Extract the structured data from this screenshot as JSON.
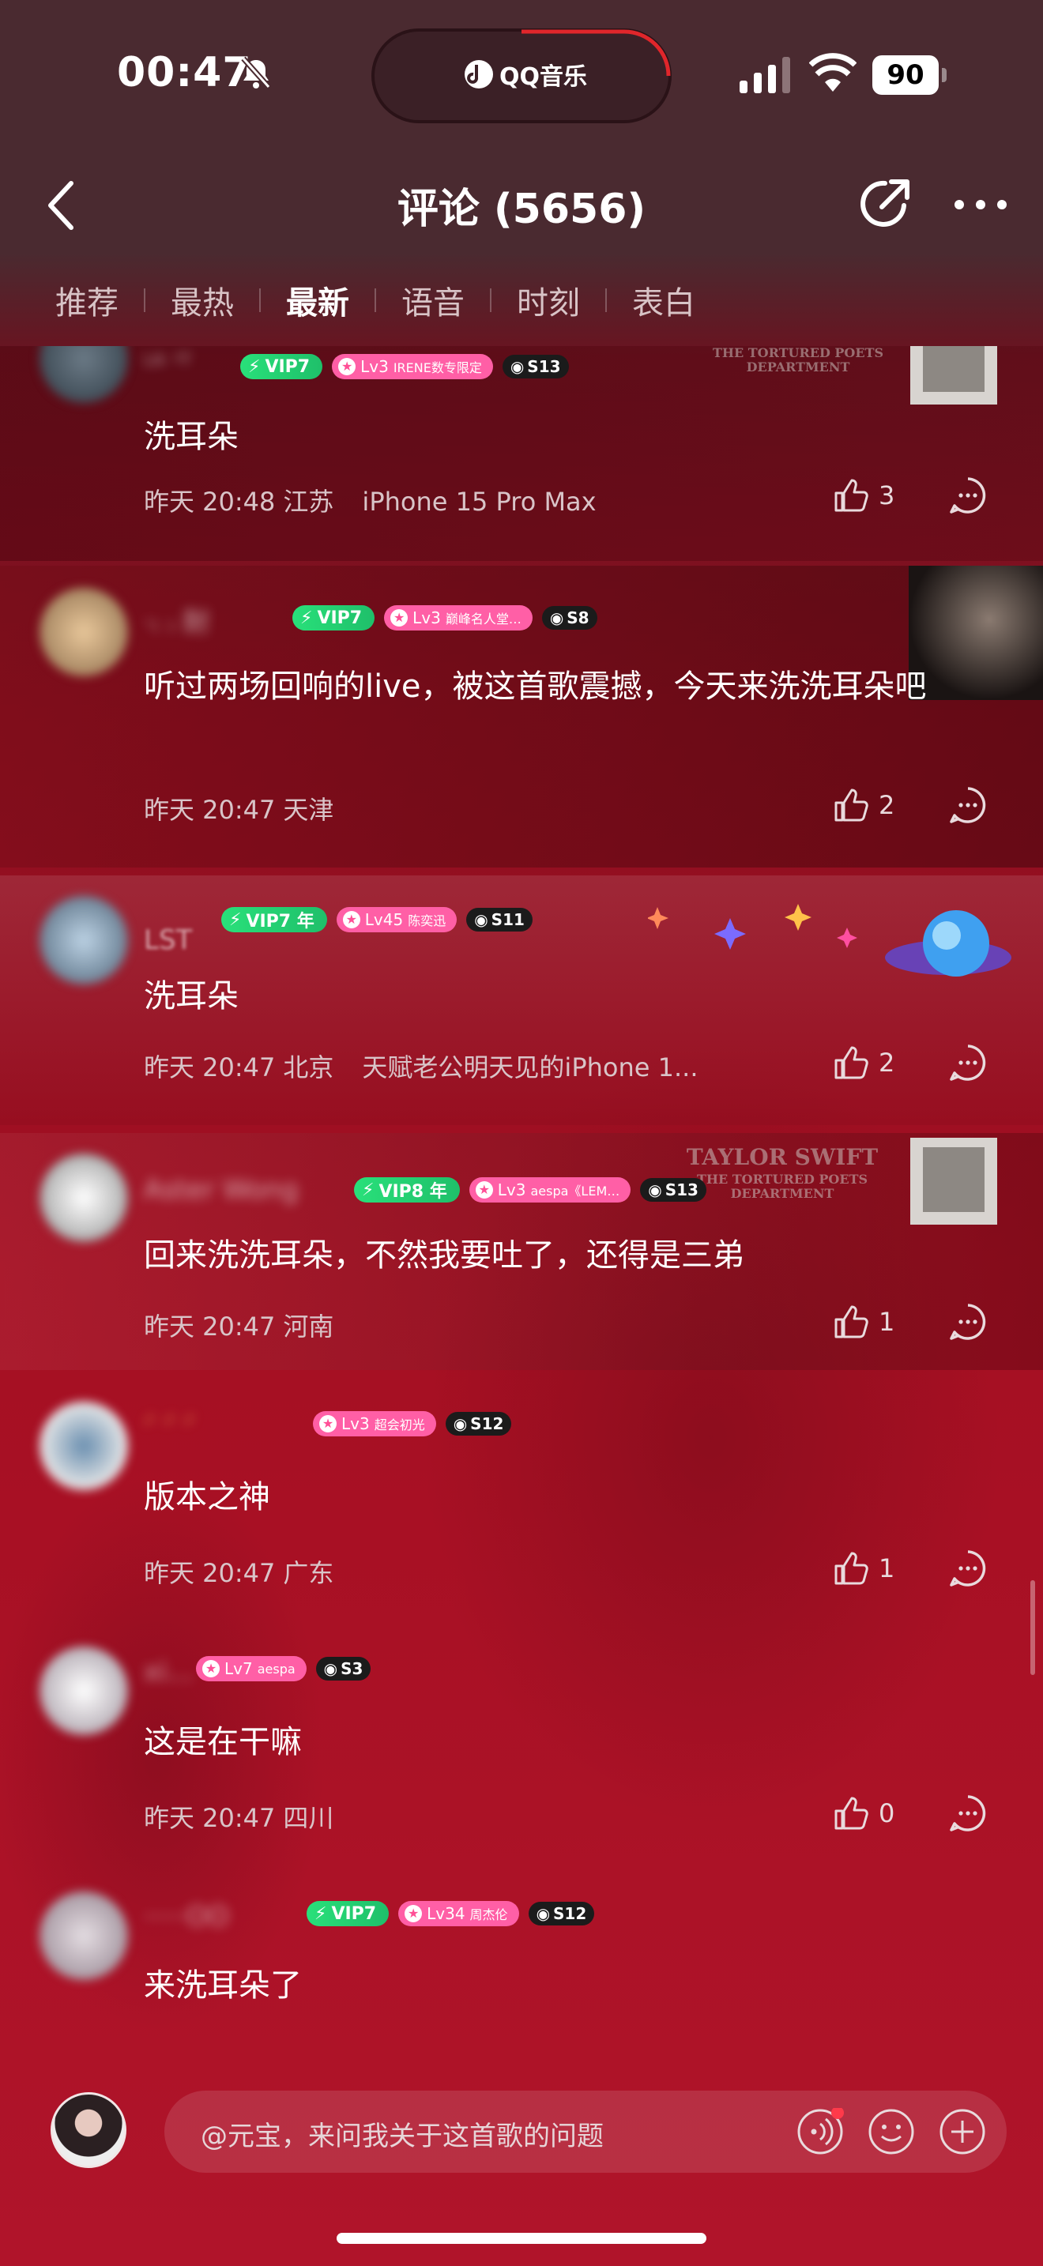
{
  "status": {
    "time": "00:47",
    "app_pill": "QQ音乐",
    "battery": "90"
  },
  "nav": {
    "title": "评论 (5656)"
  },
  "tabs": [
    {
      "label": "推荐",
      "active": false
    },
    {
      "label": "最热",
      "active": false
    },
    {
      "label": "最新",
      "active": true
    },
    {
      "label": "语音",
      "active": false
    },
    {
      "label": "时刻",
      "active": false
    },
    {
      "label": "表白",
      "active": false
    }
  ],
  "comments": [
    {
      "user": "ᴸᴬ 'ᵀ",
      "vip": "VIP7",
      "lv": "Lv3",
      "lv_tag": "IRENE数专限定",
      "s": "S13",
      "text": "洗耳朵",
      "time": "昨天 20:48",
      "location": "江苏",
      "device": "iPhone 15 Pro Max",
      "likes": "3"
    },
    {
      "user": "·₍ ₎ 耐",
      "vip": "VIP7",
      "lv": "Lv3",
      "lv_tag": "巅峰名人堂…",
      "s": "S8",
      "text": "听过两场回响的live，被这首歌震撼，今天来洗洗耳朵吧",
      "time": "昨天 20:47",
      "location": "天津",
      "device": "",
      "likes": "2"
    },
    {
      "user": "LST",
      "vip": "VIP7 年",
      "lv": "Lv45",
      "lv_tag": "陈奕迅",
      "s": "S11",
      "text": "洗耳朵",
      "time": "昨天 20:47",
      "location": "北京",
      "device": "天赋老公明天见的iPhone 1...",
      "likes": "2"
    },
    {
      "user": "Aster Wong",
      "vip": "VIP8 年",
      "lv": "Lv3",
      "lv_tag": "aespa《LEM…",
      "s": "S13",
      "text": "回来洗洗耳朵，不然我要吐了，还得是三弟",
      "time": "昨天 20:47",
      "location": "河南",
      "device": "",
      "likes": "1"
    },
    {
      "user": "ᐟ ᐟ ᐟ",
      "vip": "",
      "lv": "Lv3",
      "lv_tag": "超会初光",
      "s": "S12",
      "text": "版本之神",
      "time": "昨天 20:47",
      "location": "广东",
      "device": "",
      "likes": "1"
    },
    {
      "user": "xi…",
      "vip": "",
      "lv": "Lv7",
      "lv_tag": "aespa",
      "s": "S3",
      "text": "这是在干嘛",
      "time": "昨天 20:47",
      "location": "四川",
      "device": "",
      "likes": "0"
    },
    {
      "user": "·····OO",
      "vip": "VIP7",
      "lv": "Lv34",
      "lv_tag": "周杰伦",
      "s": "S12",
      "text": "来洗耳朵了",
      "time": "",
      "location": "",
      "device": "",
      "likes": ""
    }
  ],
  "album_text": {
    "artist": "TAYLOR SWIFT",
    "album": "THE TORTURED POETS DEPARTMENT"
  },
  "composer": {
    "placeholder": "@元宝，来问我关于这首歌的问题"
  },
  "icons": [
    "bell-slash-icon",
    "qq-music-icon",
    "signal-icon",
    "wifi-icon",
    "back-icon",
    "share-icon",
    "more-icon",
    "like-icon",
    "reply-icon",
    "voice-icon",
    "emoji-icon",
    "plus-icon"
  ],
  "colors": {
    "vip_green": "#29e07a",
    "level_pink": "#ff5fa6",
    "bg_red": "#a50f22"
  }
}
